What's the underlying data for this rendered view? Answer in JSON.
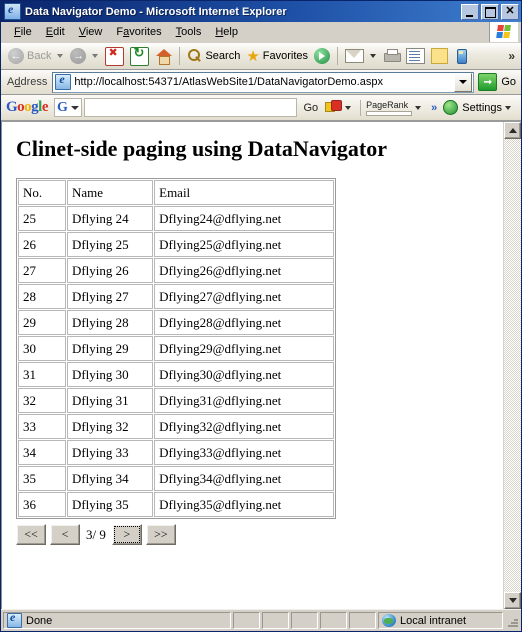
{
  "window": {
    "title": "Data Navigator Demo - Microsoft Internet Explorer",
    "icon": "ie-document-icon",
    "minimize_label": "Minimize",
    "maximize_label": "Maximize",
    "close_label": "Close"
  },
  "menu": {
    "items": [
      {
        "label": "File",
        "accel": "F"
      },
      {
        "label": "Edit",
        "accel": "E"
      },
      {
        "label": "View",
        "accel": "V"
      },
      {
        "label": "Favorites",
        "accel": "a"
      },
      {
        "label": "Tools",
        "accel": "T"
      },
      {
        "label": "Help",
        "accel": "H"
      }
    ]
  },
  "toolbar": {
    "back_label": "Back",
    "forward_label": "",
    "stop_label": "Stop",
    "refresh_label": "Refresh",
    "home_label": "Home",
    "search_label": "Search",
    "favorites_label": "Favorites",
    "media_label": "Media",
    "mail_label": "Mail",
    "print_label": "Print",
    "edit_label": "Edit",
    "notes_label": "Notes",
    "messenger_label": "Messenger",
    "overflow_label": "»"
  },
  "address": {
    "label": "Address",
    "url": "http://localhost:54371/AtlasWebSite1/DataNavigatorDemo.aspx",
    "placeholder": "",
    "go_label": "Go"
  },
  "google_toolbar": {
    "logo": {
      "g1": "G",
      "o1": "o",
      "o2": "o",
      "g2": "g",
      "l": "l",
      "e": "e"
    },
    "selector_letter": "G",
    "search_value": "",
    "search_placeholder": "",
    "go_label": "Go",
    "pagerank_label": "PageRank",
    "overflow_label": "»",
    "settings_label": "Settings"
  },
  "page": {
    "heading": "Clinet-side paging using DataNavigator",
    "table": {
      "headers": [
        "No.",
        "Name",
        "Email"
      ],
      "rows": [
        [
          "25",
          "Dflying 24",
          "Dflying24@dflying.net"
        ],
        [
          "26",
          "Dflying 25",
          "Dflying25@dflying.net"
        ],
        [
          "27",
          "Dflying 26",
          "Dflying26@dflying.net"
        ],
        [
          "28",
          "Dflying 27",
          "Dflying27@dflying.net"
        ],
        [
          "29",
          "Dflying 28",
          "Dflying28@dflying.net"
        ],
        [
          "30",
          "Dflying 29",
          "Dflying29@dflying.net"
        ],
        [
          "31",
          "Dflying 30",
          "Dflying30@dflying.net"
        ],
        [
          "32",
          "Dflying 31",
          "Dflying31@dflying.net"
        ],
        [
          "33",
          "Dflying 32",
          "Dflying32@dflying.net"
        ],
        [
          "34",
          "Dflying 33",
          "Dflying33@dflying.net"
        ],
        [
          "35",
          "Dflying 34",
          "Dflying34@dflying.net"
        ],
        [
          "36",
          "Dflying 35",
          "Dflying35@dflying.net"
        ]
      ]
    },
    "pager": {
      "first_label": "<<",
      "prev_label": "<",
      "page_info": "3/ 9",
      "current_page": "3",
      "total_pages": "9",
      "next_label": ">",
      "last_label": ">>"
    }
  },
  "scrollbar": {
    "up_label": "Scroll up",
    "down_label": "Scroll down"
  },
  "status": {
    "message": "Done",
    "zone": "Local intranet"
  },
  "colors": {
    "titlebar_start": "#0a246a",
    "titlebar_end": "#3f7fd0",
    "chrome": "#d4d0c8",
    "page_bg": "#ffffff",
    "google_blue": "#2b59c3",
    "google_red": "#d93025",
    "google_yellow": "#f2b100",
    "google_green": "#2e9e4a"
  }
}
